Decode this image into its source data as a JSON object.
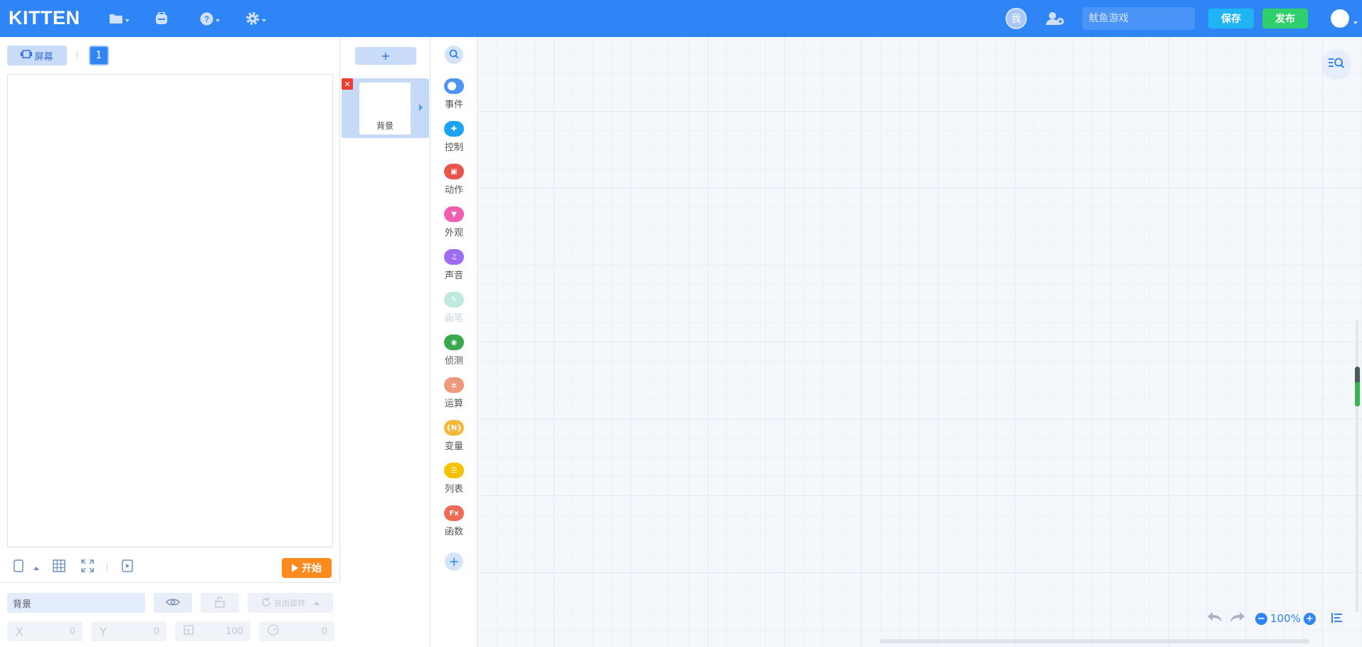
{
  "app": {
    "logo": "KITTEN"
  },
  "topbar": {
    "me_label": "我",
    "project_name_placeholder": "鱿鱼游戏",
    "save_label": "保存",
    "publish_label": "发布",
    "icons": [
      "folder-icon",
      "backpack-icon",
      "help-icon",
      "settings-icon",
      "add-user-icon"
    ]
  },
  "stage_panel": {
    "screen_tab_label": "屏幕",
    "page_number": "1",
    "start_label": "开始",
    "tools": [
      "device-portrait-icon",
      "grid-icon",
      "fullscreen-icon",
      "preview-icon"
    ]
  },
  "props": {
    "sprite_name": "背景",
    "rotation_label": "自由旋转",
    "x_label": "X",
    "x_value": "0",
    "y_label": "Y",
    "y_value": "0",
    "scale_value": "100",
    "direction_value": "0"
  },
  "sprites": {
    "add_label": "+",
    "items": [
      {
        "name": "背景",
        "selected": true
      }
    ]
  },
  "categories": [
    {
      "label": "事件",
      "icon": "toggle-icon",
      "color": "#4d94f3",
      "glyph": ""
    },
    {
      "label": "控制",
      "icon": "gamepad-icon",
      "color": "#1aa3f2",
      "glyph": "✚"
    },
    {
      "label": "动作",
      "icon": "motion-icon",
      "color": "#e9544c",
      "glyph": "▣"
    },
    {
      "label": "外观",
      "icon": "shirt-icon",
      "color": "#f05fb2",
      "glyph": "▼"
    },
    {
      "label": "声音",
      "icon": "music-note-icon",
      "color": "#9d6cf0",
      "glyph": "♫"
    },
    {
      "label": "画笔",
      "icon": "pen-icon",
      "color": "#bfe9df",
      "glyph": "✎"
    },
    {
      "label": "侦测",
      "icon": "target-icon",
      "color": "#3aa84f",
      "glyph": "◉"
    },
    {
      "label": "运算",
      "icon": "math-icon",
      "color": "#ec9a7b",
      "glyph": "±"
    },
    {
      "label": "变量",
      "icon": "variable-icon",
      "color": "#f6b83a",
      "glyph": "{N}"
    },
    {
      "label": "列表",
      "icon": "list-icon",
      "color": "#f5c100",
      "glyph": "☰"
    },
    {
      "label": "函数",
      "icon": "function-icon",
      "color": "#ef6b55",
      "glyph": "Fx"
    }
  ],
  "workspace": {
    "zoom": "100%",
    "zoom_out_label": "−",
    "zoom_in_label": "+"
  },
  "colors": {
    "topbar": "#2f84f6",
    "save": "#1fb5f5",
    "publish": "#2ecf6c",
    "start": "#ff8a1e",
    "workspace_bg": "#f4f7fc"
  }
}
